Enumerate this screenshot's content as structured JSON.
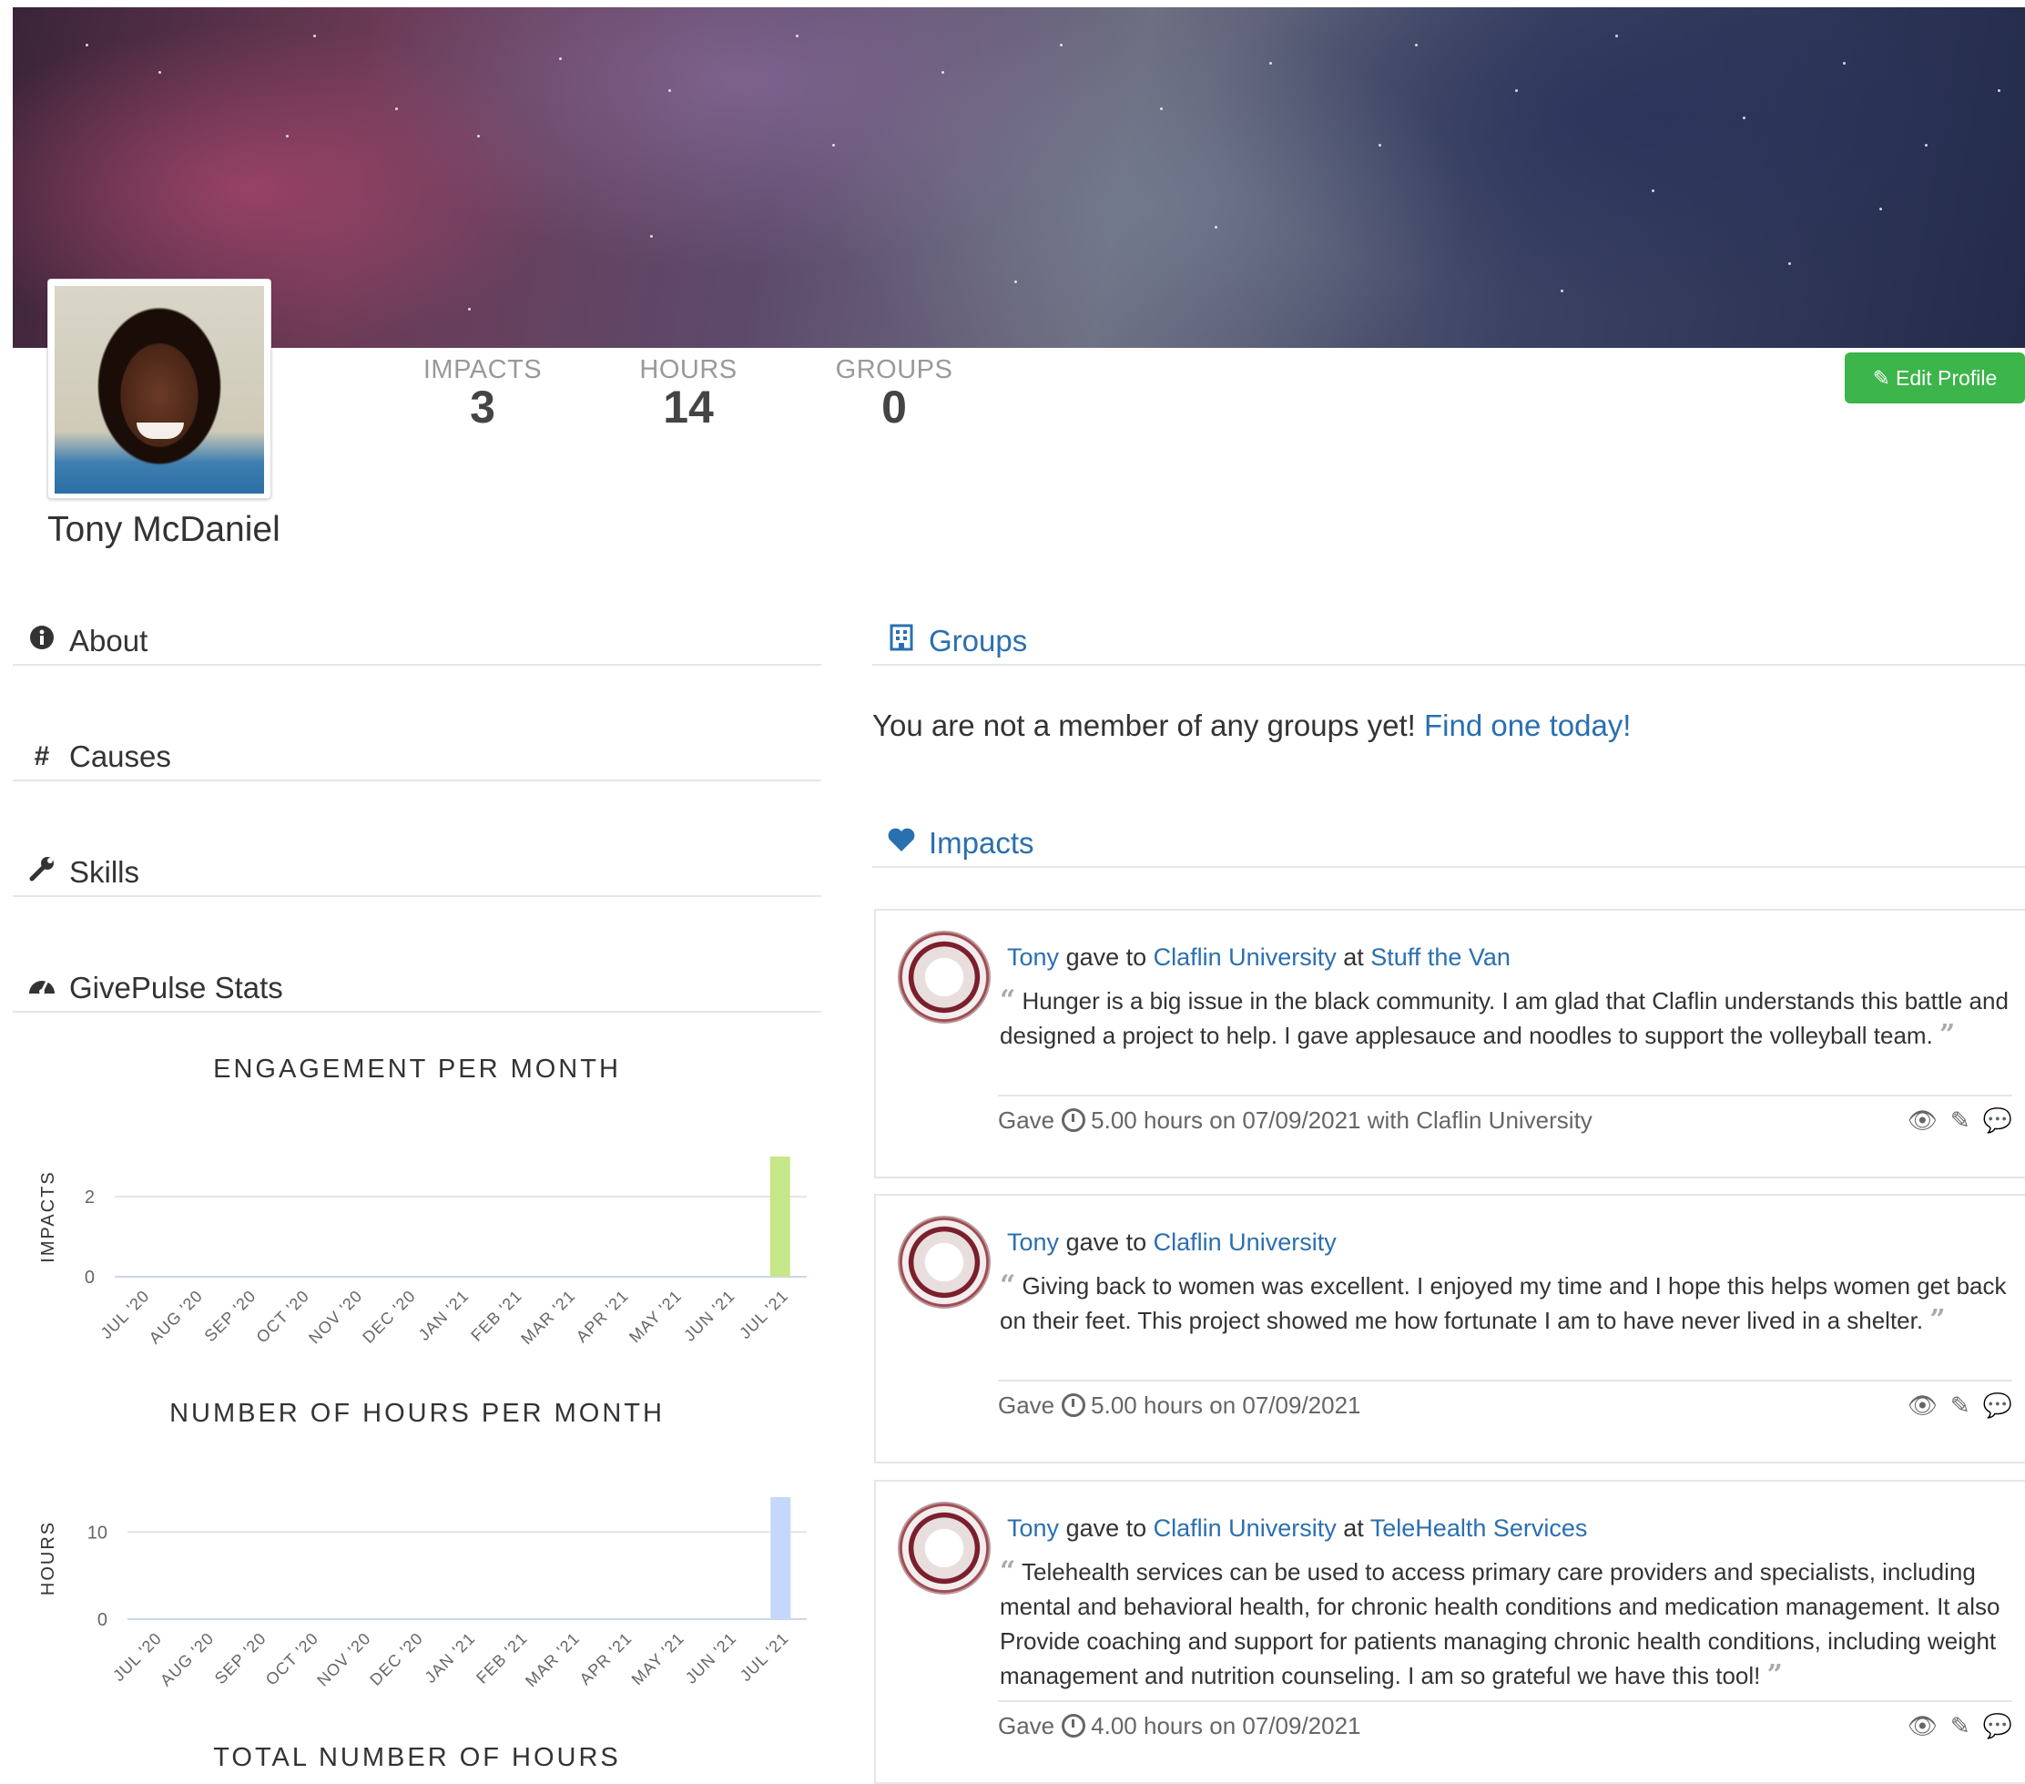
{
  "profile": {
    "name": "Tony McDaniel"
  },
  "stats": [
    {
      "label": "IMPACTS",
      "value": "3"
    },
    {
      "label": "HOURS",
      "value": "14"
    },
    {
      "label": "GROUPS",
      "value": "0"
    }
  ],
  "edit_button": {
    "icon": "pencil-icon",
    "label": "Edit Profile"
  },
  "left_sections": [
    {
      "icon": "info-icon",
      "label": "About"
    },
    {
      "icon": "hash-icon",
      "label": "Causes"
    },
    {
      "icon": "wrench-icon",
      "label": "Skills"
    },
    {
      "icon": "dashboard-icon",
      "label": "GivePulse Stats"
    }
  ],
  "charts": {
    "engagement_title": "ENGAGEMENT PER MONTH",
    "hours_title": "NUMBER OF HOURS PER MONTH",
    "total_title": "TOTAL NUMBER OF HOURS"
  },
  "chart_data": [
    {
      "type": "bar",
      "title": "ENGAGEMENT PER MONTH",
      "ylabel": "IMPACTS",
      "xlabel": "",
      "categories": [
        "JUL '20",
        "AUG '20",
        "SEP '20",
        "OCT '20",
        "NOV '20",
        "DEC '20",
        "JAN '21",
        "FEB '21",
        "MAR '21",
        "APR '21",
        "MAY '21",
        "JUN '21",
        "JUL '21"
      ],
      "values": [
        0,
        0,
        0,
        0,
        0,
        0,
        0,
        0,
        0,
        0,
        0,
        0,
        3
      ],
      "yticks": [
        0,
        2
      ],
      "ylim": [
        0,
        3
      ],
      "color": "#c6e68a",
      "grid": true
    },
    {
      "type": "bar",
      "title": "NUMBER OF HOURS PER MONTH",
      "ylabel": "HOURS",
      "xlabel": "",
      "categories": [
        "JUL '20",
        "AUG '20",
        "SEP '20",
        "OCT '20",
        "NOV '20",
        "DEC '20",
        "JAN '21",
        "FEB '21",
        "MAR '21",
        "APR '21",
        "MAY '21",
        "JUN '21",
        "JUL '21"
      ],
      "values": [
        0,
        0,
        0,
        0,
        0,
        0,
        0,
        0,
        0,
        0,
        0,
        0,
        14
      ],
      "yticks": [
        0,
        10
      ],
      "ylim": [
        0,
        14
      ],
      "color": "#c5d8fb",
      "grid": true
    }
  ],
  "groups": {
    "icon": "building-icon",
    "title": "Groups",
    "message": "You are not a member of any groups yet!",
    "link": "Find one today!"
  },
  "impacts": {
    "icon": "heart-icon",
    "title": "Impacts",
    "items": [
      {
        "user": "Tony",
        "gave_to_text": "gave to",
        "org": "Claflin University",
        "at_text": "at",
        "event": "Stuff the Van",
        "quote": "Hunger is a big issue in the black community. I am glad that Claflin understands this battle and designed a project to help. I gave applesauce and noodles to support the volleyball team.",
        "foot_gave": "Gave",
        "foot_detail": "5.00 hours on 07/09/2021 with Claflin University"
      },
      {
        "user": "Tony",
        "gave_to_text": "gave to",
        "org": "Claflin University",
        "at_text": "",
        "event": "",
        "quote": "Giving back to women was excellent. I enjoyed my time and I hope this helps women get back on their feet. This project showed me how fortunate I am to have never lived in a shelter.",
        "foot_gave": "Gave",
        "foot_detail": "5.00 hours on 07/09/2021"
      },
      {
        "user": "Tony",
        "gave_to_text": "gave to",
        "org": "Claflin University",
        "at_text": "at",
        "event": "TeleHealth Services",
        "quote": "Telehealth services can be used to access primary care providers and specialists, including mental and behavioral health, for chronic health conditions and medication management. It also Provide coaching and support for patients managing chronic health conditions, including weight management and nutrition counseling. I am so grateful we have this tool!",
        "foot_gave": "Gave",
        "foot_detail": "4.00 hours on 07/09/2021"
      }
    ]
  }
}
